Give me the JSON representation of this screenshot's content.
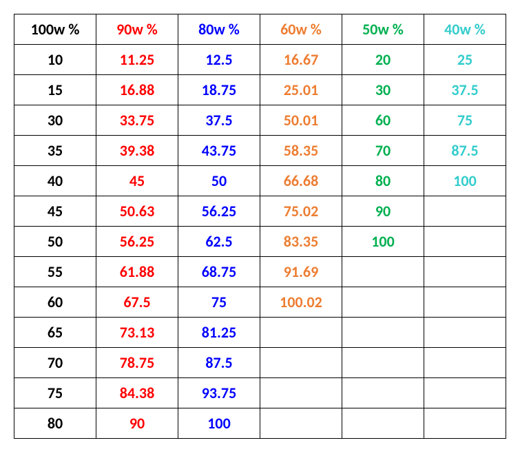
{
  "chart_data": {
    "type": "table",
    "title": "",
    "columns": [
      "100w %",
      "90w %",
      "80w %",
      "60w %",
      "50w %",
      "40w %"
    ],
    "column_colors": [
      "#000000",
      "#ff0000",
      "#0000ff",
      "#ed7d31",
      "#00b050",
      "#33cccc"
    ],
    "rows": [
      [
        "10",
        "11.25",
        "12.5",
        "16.67",
        "20",
        "25"
      ],
      [
        "15",
        "16.88",
        "18.75",
        "25.01",
        "30",
        "37.5"
      ],
      [
        "30",
        "33.75",
        "37.5",
        "50.01",
        "60",
        "75"
      ],
      [
        "35",
        "39.38",
        "43.75",
        "58.35",
        "70",
        "87.5"
      ],
      [
        "40",
        "45",
        "50",
        "66.68",
        "80",
        "100"
      ],
      [
        "45",
        "50.63",
        "56.25",
        "75.02",
        "90",
        ""
      ],
      [
        "50",
        "56.25",
        "62.5",
        "83.35",
        "100",
        ""
      ],
      [
        "55",
        "61.88",
        "68.75",
        "91.69",
        "",
        ""
      ],
      [
        "60",
        "67.5",
        "75",
        "100.02",
        "",
        ""
      ],
      [
        "65",
        "73.13",
        "81.25",
        "",
        "",
        ""
      ],
      [
        "70",
        "78.75",
        "87.5",
        "",
        "",
        ""
      ],
      [
        "75",
        "84.38",
        "93.75",
        "",
        "",
        ""
      ],
      [
        "80",
        "90",
        "100",
        "",
        "",
        ""
      ]
    ]
  }
}
